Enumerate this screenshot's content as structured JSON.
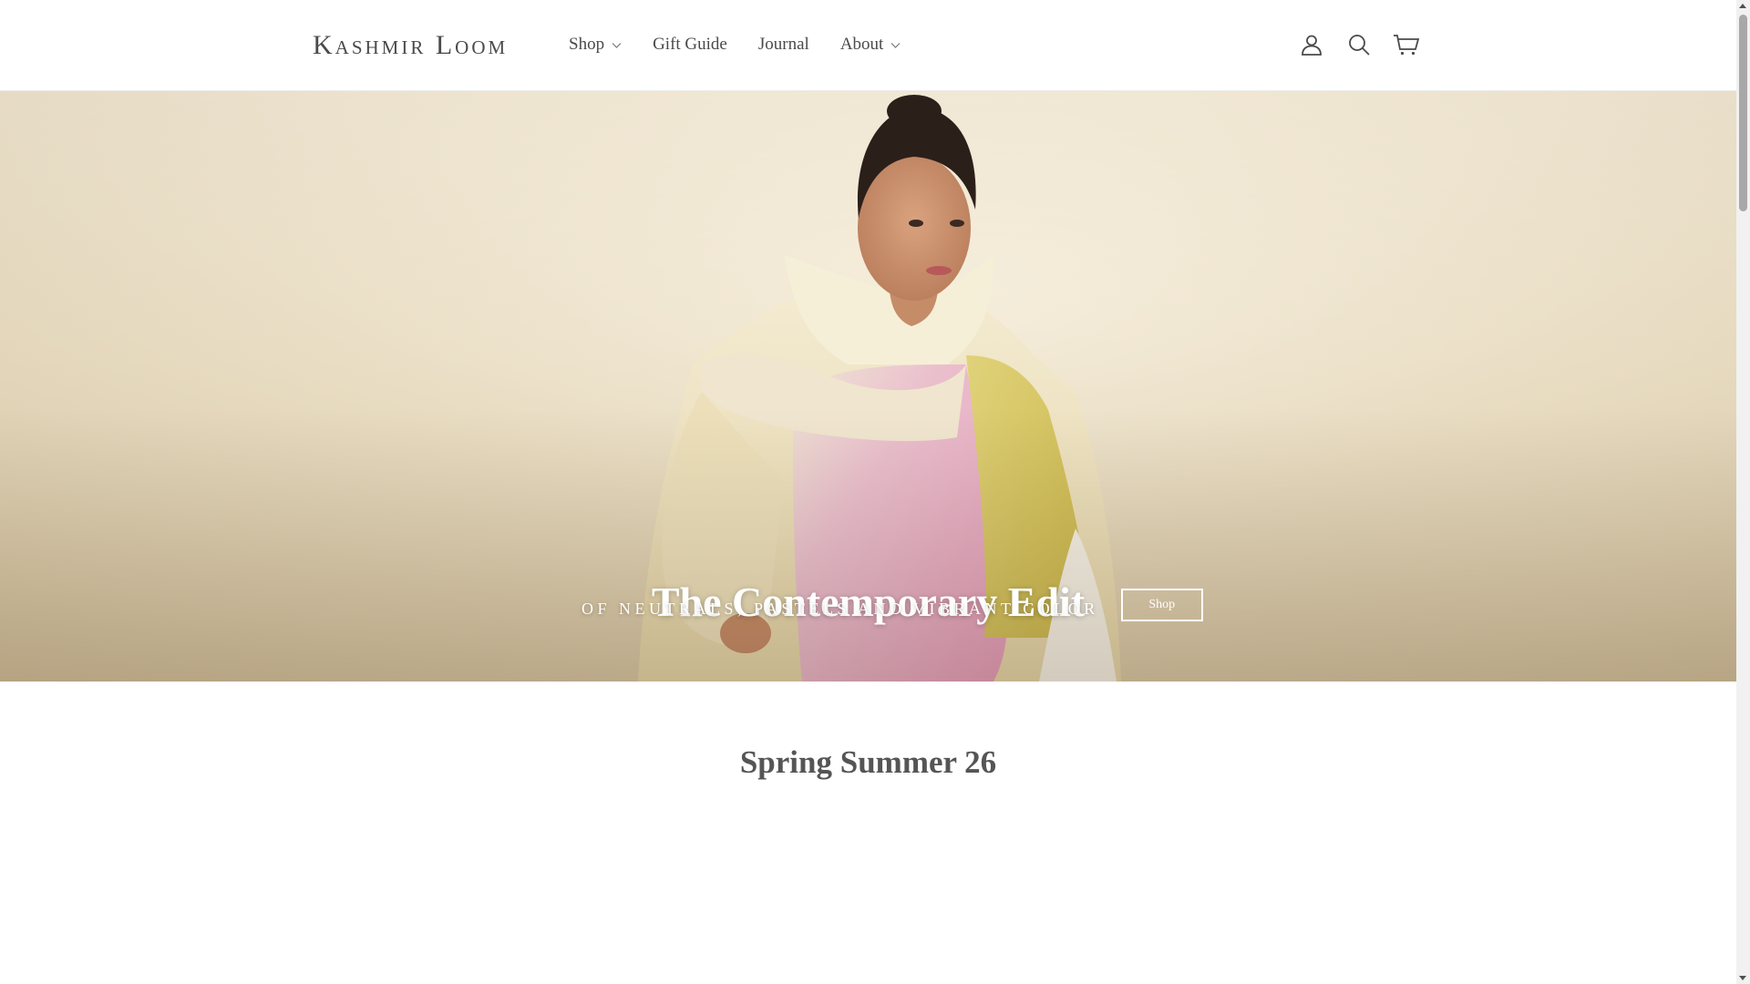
{
  "brand": {
    "logo_text": "Kashmir Loom"
  },
  "nav": {
    "items": [
      {
        "label": "Shop",
        "has_dropdown": true
      },
      {
        "label": "Gift Guide",
        "has_dropdown": false
      },
      {
        "label": "Journal",
        "has_dropdown": false
      },
      {
        "label": "About",
        "has_dropdown": true
      }
    ]
  },
  "header_icons": [
    "account-icon",
    "search-icon",
    "cart-icon"
  ],
  "hero": {
    "title": "The Contemporary Edit",
    "subtitle": "OF NEUTRALS, PASTELS AND VIBRANT COLOR",
    "button_label": "Shop"
  },
  "section": {
    "title": "Spring Summer 26"
  },
  "colors": {
    "text": "#4a4a4a",
    "hero_text": "#ffffff",
    "scarf_pink": "#e7a6bd",
    "scarf_yellow": "#d6c45a",
    "coat_cream": "#efe3c1"
  }
}
